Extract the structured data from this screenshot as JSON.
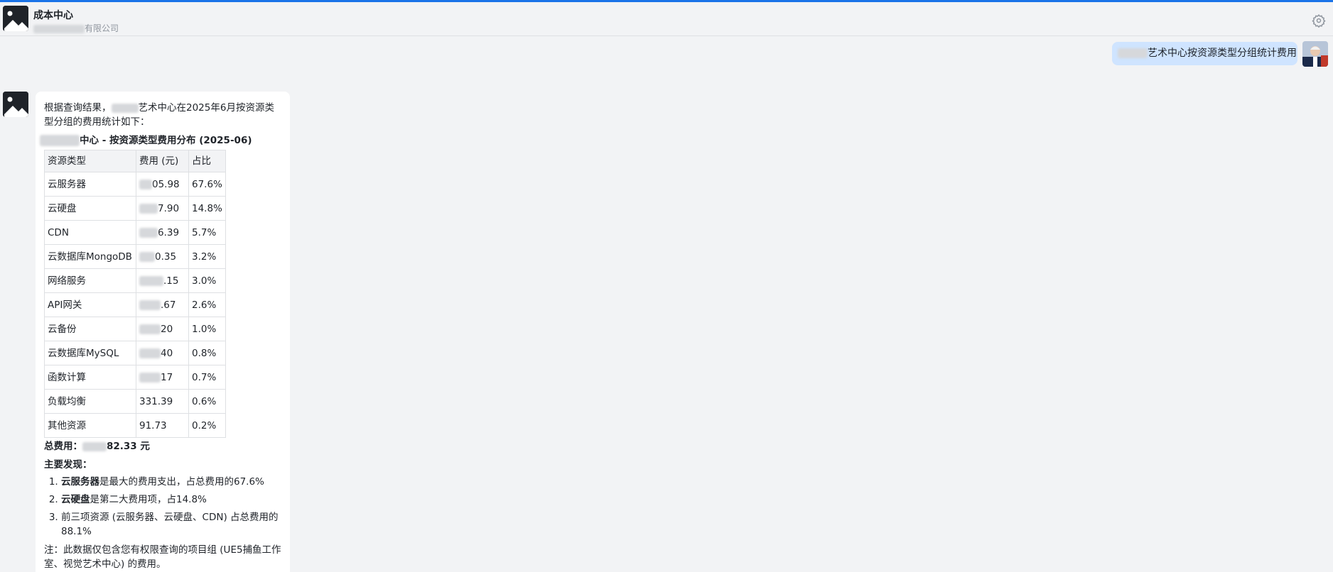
{
  "header": {
    "title": "成本中心",
    "subtitle": "有限公司"
  },
  "user_message": "艺术中心按资源类型分组统计费用",
  "bot": {
    "intro_prefix": "根据查询结果，",
    "intro_suffix": "艺术中心在2025年6月按资源类型分组的费用统计如下：",
    "table_title": "中心 - 按资源类型费用分布 (2025-06)",
    "table": {
      "headers": [
        "资源类型",
        "费用 (元)",
        "占比"
      ],
      "rows": [
        {
          "type": "云服务器",
          "cost": "05.98",
          "share": "67.6%"
        },
        {
          "type": "云硬盘",
          "cost": "7.90",
          "share": "14.8%"
        },
        {
          "type": "CDN",
          "cost": "6.39",
          "share": "5.7%"
        },
        {
          "type": "云数据库MongoDB",
          "cost": "0.35",
          "share": "3.2%"
        },
        {
          "type": "网络服务",
          "cost": ".15",
          "share": "3.0%"
        },
        {
          "type": "API网关",
          "cost": ".67",
          "share": "2.6%"
        },
        {
          "type": "云备份",
          "cost": "20",
          "share": "1.0%"
        },
        {
          "type": "云数据库MySQL",
          "cost": "40",
          "share": "0.8%"
        },
        {
          "type": "函数计算",
          "cost": "17",
          "share": "0.7%"
        },
        {
          "type": "负载均衡",
          "cost": "331.39",
          "share": "0.6%"
        },
        {
          "type": "其他资源",
          "cost": "91.73",
          "share": "0.2%"
        }
      ]
    },
    "total_label": "总费用：",
    "total_value": "82.33 元",
    "findings_title": "主要发现：",
    "findings": [
      {
        "bold": "云服务器",
        "text": "是最大的费用支出，占总费用的67.6%"
      },
      {
        "bold": "云硬盘",
        "text": "是第二大费用项，占14.8%"
      },
      {
        "bold": "",
        "text": "前三项资源 (云服务器、云硬盘、CDN) 占总费用的88.1%"
      }
    ],
    "note": "注：此数据仅包含您有权限查询的项目组 (UE5捕鱼工作室、视觉艺术中心) 的费用。"
  }
}
